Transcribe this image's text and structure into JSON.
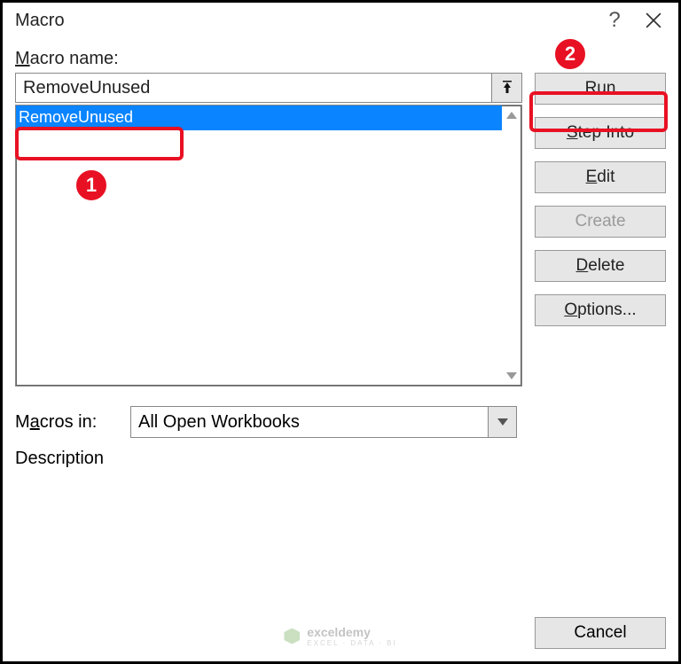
{
  "title": "Macro",
  "labels": {
    "macro_name": "Macro name:",
    "macros_in": "Macros in:",
    "description": "Description"
  },
  "macro_name_value": "RemoveUnused",
  "macro_list": {
    "selected": "RemoveUnused"
  },
  "macros_in_value": "All Open Workbooks",
  "buttons": {
    "run": "Run",
    "step_into": "Step Into",
    "edit": "Edit",
    "create": "Create",
    "delete": "Delete",
    "options": "Options...",
    "cancel": "Cancel"
  },
  "callouts": {
    "badge1": "1",
    "badge2": "2"
  },
  "watermark": {
    "brand": "exceldemy",
    "tagline": "EXCEL · DATA · BI"
  }
}
